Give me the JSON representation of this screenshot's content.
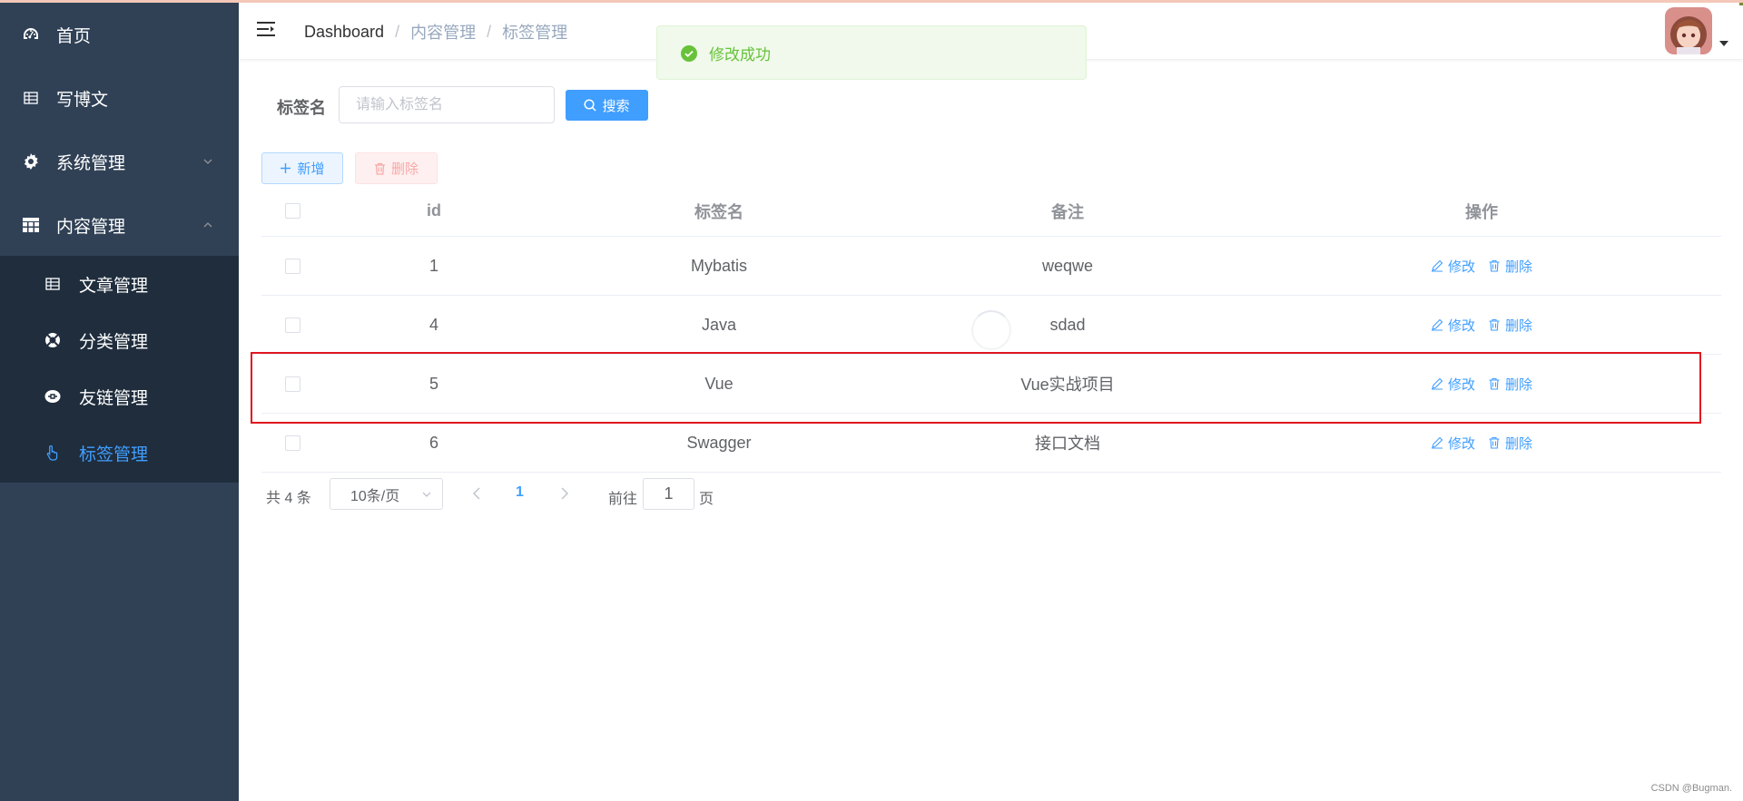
{
  "sidebar": {
    "items": [
      {
        "label": "首页",
        "icon": "dashboard-icon"
      },
      {
        "label": "写博文",
        "icon": "table-icon"
      },
      {
        "label": "系统管理",
        "icon": "gear-icon"
      },
      {
        "label": "内容管理",
        "icon": "grid-icon"
      }
    ],
    "subitems": [
      {
        "label": "文章管理",
        "icon": "table-icon"
      },
      {
        "label": "分类管理",
        "icon": "lifebuoy-icon"
      },
      {
        "label": "友链管理",
        "icon": "link-badge-icon"
      },
      {
        "label": "标签管理",
        "icon": "hand-pointer-icon",
        "active": true
      }
    ]
  },
  "header": {
    "breadcrumb": [
      "Dashboard",
      "内容管理",
      "标签管理"
    ],
    "separator": "/"
  },
  "toast": {
    "message": "修改成功",
    "type": "success"
  },
  "search": {
    "label": "标签名",
    "placeholder": "请输入标签名",
    "button_label": "搜索"
  },
  "actions": {
    "add_label": "新增",
    "delete_label": "删除"
  },
  "table": {
    "columns": [
      "id",
      "标签名",
      "备注",
      "操作"
    ],
    "rows": [
      {
        "id": "1",
        "name": "Mybatis",
        "note": "weqwe"
      },
      {
        "id": "4",
        "name": "Java",
        "note": "sdad"
      },
      {
        "id": "5",
        "name": "Vue",
        "note": "Vue实战项目",
        "highlighted": true
      },
      {
        "id": "6",
        "name": "Swagger",
        "note": "接口文档"
      }
    ],
    "op_edit": "修改",
    "op_delete": "删除"
  },
  "pagination": {
    "total_text": "共 4 条",
    "page_size": "10条/页",
    "current_page": "1",
    "goto_label": "前往",
    "goto_value": "1",
    "page_suffix": "页"
  },
  "watermark": "CSDN @Bugman.",
  "colors": {
    "sidebar_bg": "#304156",
    "submenu_bg": "#1f2d3d",
    "primary": "#409eff",
    "success": "#67c23a",
    "highlight": "#e0161f"
  }
}
